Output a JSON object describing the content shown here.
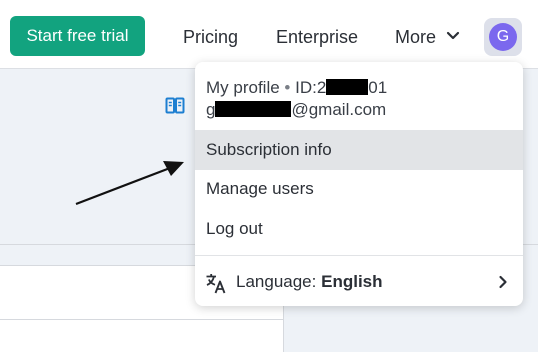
{
  "header": {
    "trial_button_label": "Start free trial",
    "nav": {
      "pricing": "Pricing",
      "enterprise": "Enterprise",
      "more": "More"
    },
    "avatar_initial": "G"
  },
  "account_menu": {
    "profile_label": "My profile",
    "id_prefix": "ID:2",
    "id_suffix": "01",
    "email_prefix": "g",
    "email_suffix": "@gmail.com",
    "items": {
      "subscription": "Subscription info",
      "manage_users": "Manage users",
      "logout": "Log out"
    },
    "language_label": "Language:",
    "language_value": "English"
  },
  "colors": {
    "brand_green": "#12a37f",
    "avatar_purple": "#7b68ee",
    "hover_gray": "#e2e4e7",
    "link_blue": "#1d7fd1"
  },
  "icons": {
    "book": "book-open-icon",
    "chevron": "chevron-down-icon",
    "language": "translate-icon",
    "submenu": "chevron-right-icon"
  }
}
